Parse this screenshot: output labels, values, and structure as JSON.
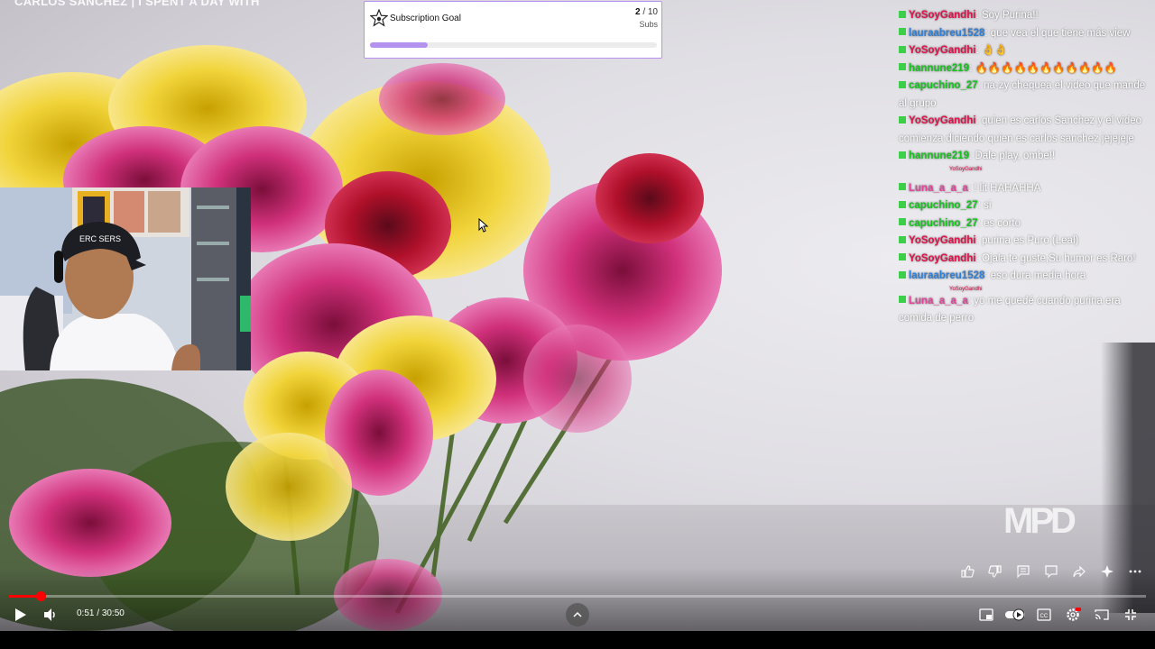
{
  "video": {
    "title": "CARLOS SANCHEZ | I SPENT A DAY WITH",
    "current_time": "0:51",
    "duration": "30:50",
    "time_separator": "/",
    "progress_fraction": 0.0276
  },
  "goal": {
    "title": "Subscription Goal",
    "current": "2",
    "target": "10",
    "separator": "/",
    "unit": "Subs",
    "fill_fraction": 0.2
  },
  "chat": {
    "messages": [
      {
        "user": "YoSoyGandhi",
        "color": "#e0114a",
        "text": "Soy Purina!!"
      },
      {
        "user": "lauraabreu1528",
        "color": "#2f7fd6",
        "text": "que vea el que tiene más view"
      },
      {
        "user": "YoSoyGandhi",
        "color": "#e0114a",
        "text": "👌👌"
      },
      {
        "user": "hannune219",
        "color": "#17c21f",
        "text": "🔥🔥🔥🔥🔥🔥🔥🔥🔥🔥🔥"
      },
      {
        "user": "capuchino_27",
        "color": "#17c21f",
        "text": "na-zy chequea el video que mande al grupo"
      },
      {
        "user": "YoSoyGandhi",
        "color": "#e0114a",
        "text": "quien es carlos Sanchez y el video comienza diciendo quien es carlos sanchez jejejeje"
      },
      {
        "user": "hannune219",
        "color": "#17c21f",
        "text": "Dale play, ombe!!",
        "reply": "YoSoyGandhi"
      },
      {
        "user": "Luna_a_a_a",
        "color": "#e0459a",
        "text": "! lit HAHAHHA"
      },
      {
        "user": "capuchino_27",
        "color": "#17c21f",
        "text": "si"
      },
      {
        "user": "capuchino_27",
        "color": "#17c21f",
        "text": "es corto"
      },
      {
        "user": "YoSoyGandhi",
        "color": "#e0114a",
        "text": "purina es Puro (Leal)"
      },
      {
        "user": "YoSoyGandhi",
        "color": "#e0114a",
        "text": "Ojala te guste,Su humor es Raro!"
      },
      {
        "user": "lauraabreu1528",
        "color": "#2f7fd6",
        "text": "eso dura media hora",
        "reply": "YoSoyGandhi"
      },
      {
        "user": "Luna_a_a_a",
        "color": "#e0459a",
        "text": "yo me quedé cuando purina era comida de perro"
      }
    ]
  },
  "watermark": {
    "text": "MPD"
  },
  "actions": {
    "icons": [
      "like-icon",
      "dislike-icon",
      "comment-icon",
      "chat-icon",
      "share-icon",
      "remix-icon",
      "more-icon"
    ]
  },
  "controls": {
    "icons": [
      "play-icon",
      "volume-icon",
      "chevron-up-icon",
      "autoplay-toggle",
      "captions-icon",
      "settings-icon",
      "cast-icon",
      "exit-fullscreen-icon"
    ]
  },
  "colors": {
    "accent_red": "#ff0000",
    "goal_purple": "#b492f0",
    "badge_green": "#3ecf4a"
  }
}
